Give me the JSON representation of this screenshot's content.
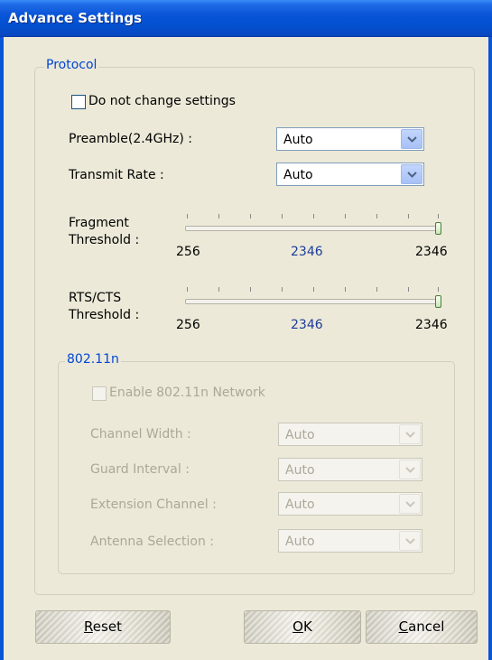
{
  "window": {
    "title": "Advance Settings"
  },
  "protocol": {
    "legend": "Protocol",
    "do_not_change": {
      "label": "Do not change settings",
      "checked": false
    },
    "preamble": {
      "label": "Preamble(2.4GHz) :",
      "value": "Auto"
    },
    "transmit_rate": {
      "label": "Transmit Rate :",
      "value": "Auto"
    },
    "fragment": {
      "label_line1": "Fragment",
      "label_line2": "Threshold :",
      "min": "256",
      "current": "2346",
      "max": "2346",
      "level": 1.0
    },
    "rts": {
      "label_line1": "RTS/CTS",
      "label_line2": "Threshold :",
      "min": "256",
      "current": "2346",
      "max": "2346",
      "level": 1.0
    }
  },
  "n80211": {
    "legend": "802.11n",
    "enable": {
      "label": "Enable 802.11n Network",
      "checked": false
    },
    "channel_width": {
      "label": "Channel Width :",
      "value": "Auto"
    },
    "guard_interval": {
      "label": "Guard Interval :",
      "value": "Auto"
    },
    "extension_channel": {
      "label": "Extension Channel :",
      "value": "Auto"
    },
    "antenna_selection": {
      "label": "Antenna Selection :",
      "value": "Auto"
    }
  },
  "buttons": {
    "reset": {
      "mnemonic": "R",
      "rest": "eset"
    },
    "ok": {
      "mnemonic": "O",
      "rest": "K"
    },
    "cancel": {
      "mnemonic": "C",
      "rest": "ancel"
    }
  }
}
